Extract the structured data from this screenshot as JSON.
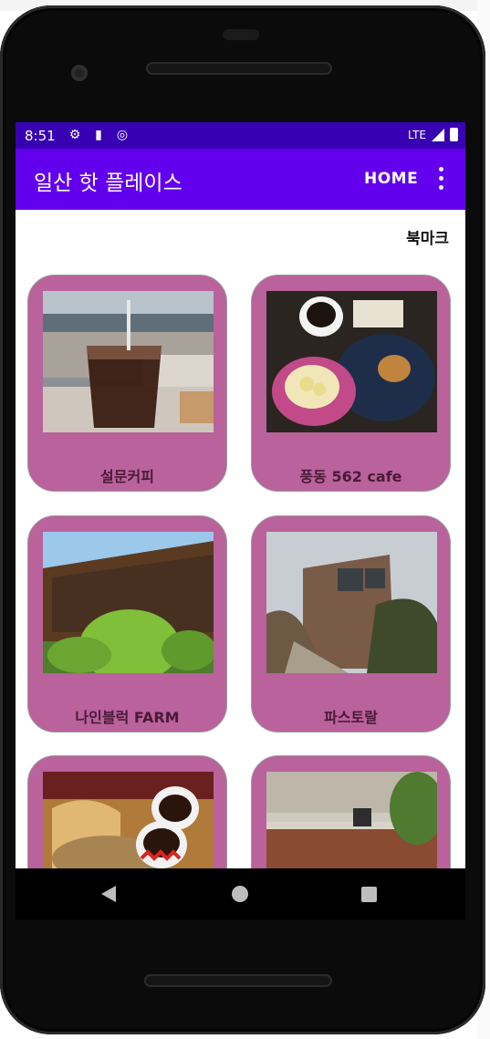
{
  "status_bar": {
    "time": "8:51",
    "network": "LTE"
  },
  "app_bar": {
    "title": "일산 핫 플레이스",
    "home_label": "HOME"
  },
  "bookmark_label": "북마크",
  "places": [
    {
      "name": "설문커피",
      "icon": "iced-coffee-photo"
    },
    {
      "name": "풍동 562 cafe",
      "icon": "coffee-dessert-photo"
    },
    {
      "name": "나인블럭 FARM",
      "icon": "block-coffee-building-photo"
    },
    {
      "name": "파스토랄",
      "icon": "brick-cafe-building-photo"
    },
    {
      "name": "",
      "icon": "bread-coffee-photo"
    },
    {
      "name": "",
      "icon": "cafe-interior-photo"
    }
  ],
  "colors": {
    "status_bar": "#3700b3",
    "app_bar": "#6200ee",
    "card": "#b9629b",
    "card_text": "#4a1a38"
  }
}
